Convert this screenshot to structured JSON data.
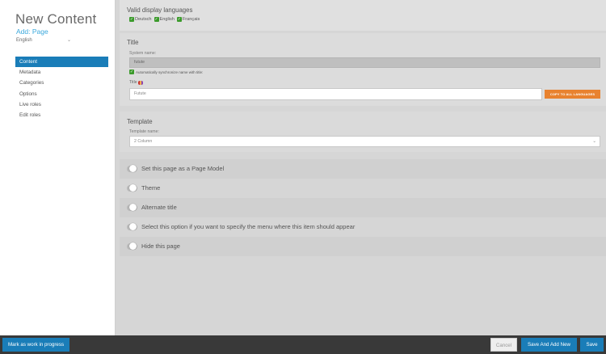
{
  "sidebar": {
    "title": "New Content",
    "subtitle": "Add: Page",
    "language": "English",
    "items": [
      {
        "label": "Content",
        "active": true
      },
      {
        "label": "Metadata"
      },
      {
        "label": "Categories"
      },
      {
        "label": "Options"
      },
      {
        "label": "Live roles"
      },
      {
        "label": "Edit roles"
      }
    ]
  },
  "languages": {
    "heading": "Valid display languages",
    "options": [
      {
        "label": "Deutsch",
        "checked": true
      },
      {
        "label": "English",
        "checked": true
      },
      {
        "label": "Français",
        "checked": true
      }
    ]
  },
  "title_section": {
    "heading": "Title",
    "system_name_label": "System name:",
    "system_name_value": "futute",
    "auto_sync_label": "Automatically synchronize name with title:",
    "title_label": "Title",
    "title_value": "Futute",
    "copy_button": "COPY TO ALL LANGUAGES"
  },
  "template_section": {
    "heading": "Template",
    "template_label": "Template name:",
    "template_value": "2 Column"
  },
  "toggles": [
    {
      "label": "Set this page as a Page Model",
      "on": false
    },
    {
      "label": "Theme",
      "on": false
    },
    {
      "label": "Alternate title",
      "on": false
    },
    {
      "label": "Select this option if you want to specify the menu where this item should appear",
      "on": false
    },
    {
      "label": "Hide this page",
      "on": false
    }
  ],
  "footer": {
    "wip_button": "Mark as work in progress",
    "cancel_button": "Cancel",
    "save_add_button": "Save And Add New",
    "save_button": "Save"
  },
  "colors": {
    "accent": "#1a7db8",
    "orange": "#e8822f",
    "check_green": "#3a9a2a",
    "subtitle_blue": "#3aa8dc"
  }
}
